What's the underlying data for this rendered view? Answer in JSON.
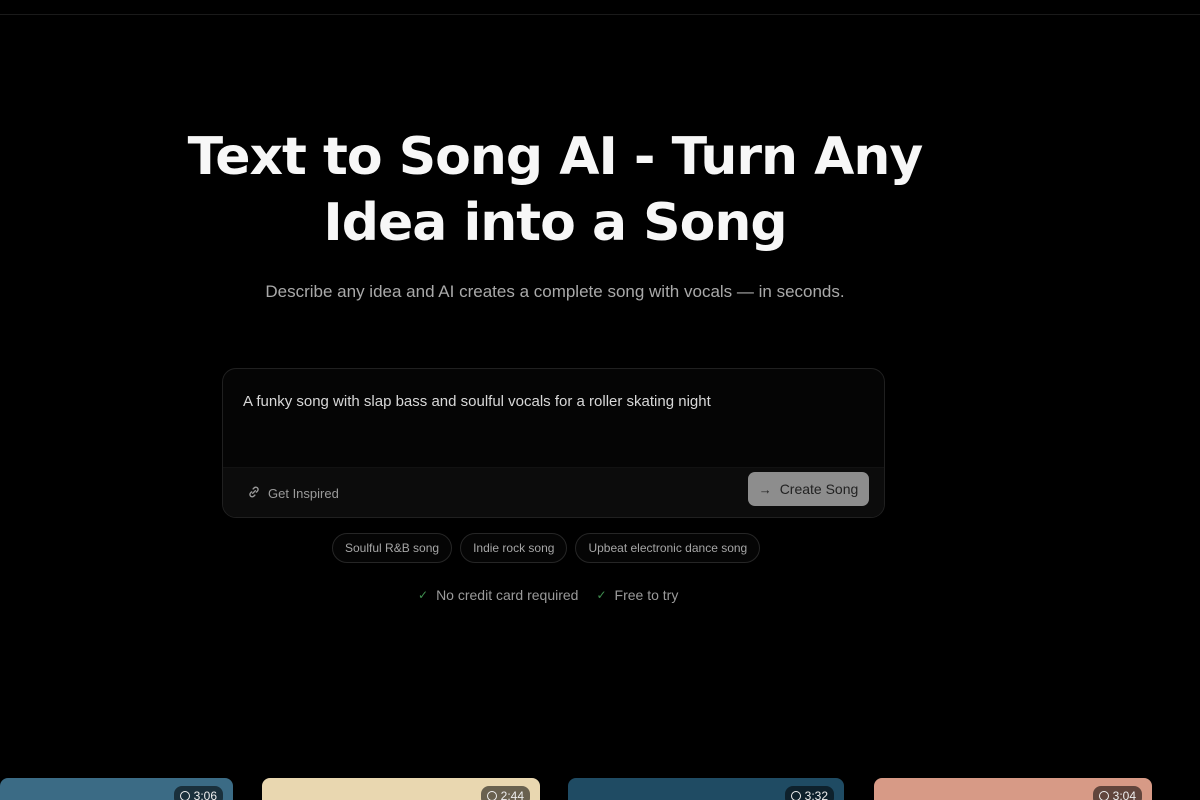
{
  "hero": {
    "title": "Text to Song AI - Turn Any Idea into a Song",
    "subtitle": "Describe any idea and AI creates a complete song with vocals — in seconds."
  },
  "prompt": {
    "value": "A funky song with slap bass and soulful vocals for a roller skating night",
    "get_inspired_label": "Get Inspired",
    "create_label": "Create Song"
  },
  "suggestions": [
    "Soulful R&B song",
    "Indie rock song",
    "Upbeat electronic dance song"
  ],
  "perks": [
    "No credit card required",
    "Free to try"
  ],
  "songs": [
    {
      "duration": "3:06",
      "color": "#3b6b85"
    },
    {
      "duration": "2:44",
      "color": "#e9d7b0"
    },
    {
      "duration": "3:32",
      "color": "#1f4b63"
    },
    {
      "duration": "3:04",
      "color": "#d79a86"
    }
  ],
  "colors": {
    "background": "#000000",
    "accent_check": "#3f8f4f",
    "create_button": "#8d8d8d"
  }
}
